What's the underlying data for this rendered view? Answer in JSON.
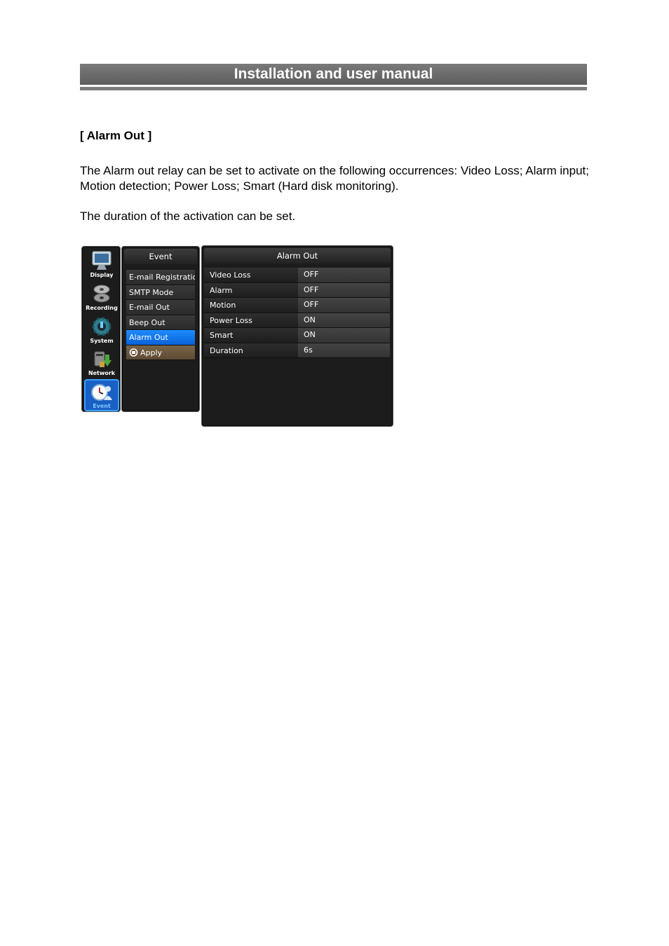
{
  "header": {
    "title": "Installation and user manual"
  },
  "section_title": "[ Alarm Out ]",
  "paragraphs": [
    "The Alarm out relay can be set to activate on the following occurrences: Video Loss; Alarm input; Motion detection; Power Loss; Smart (Hard disk monitoring).",
    "The duration of the activation can be set."
  ],
  "osd": {
    "sidebar": [
      {
        "label": "Display",
        "icon": "monitor-icon"
      },
      {
        "label": "Recording",
        "icon": "reels-icon"
      },
      {
        "label": "System",
        "icon": "gear-icon"
      },
      {
        "label": "Network",
        "icon": "network-icon"
      },
      {
        "label": "Event",
        "icon": "clock-person-icon",
        "active": true
      }
    ],
    "menu": {
      "title": "Event",
      "items": [
        "E-mail Registration",
        "SMTP Mode",
        "E-mail Out",
        "Beep Out",
        "Alarm Out",
        "Apply"
      ],
      "selected": "Alarm Out"
    },
    "detail": {
      "title": "Alarm Out",
      "rows": [
        {
          "label": "Video Loss",
          "value": "OFF"
        },
        {
          "label": "Alarm",
          "value": "OFF"
        },
        {
          "label": "Motion",
          "value": "OFF"
        },
        {
          "label": "Power Loss",
          "value": "ON"
        },
        {
          "label": "Smart",
          "value": "ON"
        },
        {
          "label": "Duration",
          "value": "6s"
        }
      ]
    },
    "colors": {
      "selected": "#1f8cff",
      "apply": "#7a6548",
      "panel": "#1c1c1c"
    }
  }
}
